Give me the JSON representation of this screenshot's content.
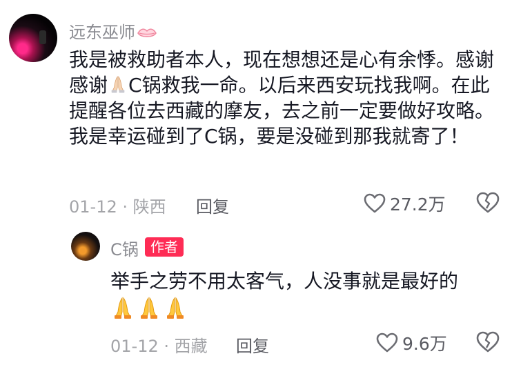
{
  "comment": {
    "author": "远东巫师",
    "author_icon": "lips-icon",
    "text_1": "我是被救助者本人，现在想想还是心有余悸。感谢感谢",
    "text_emoji": "pray-icon",
    "text_2": "C锅救我一命。以后来西安玩找我啊。在此提醒各位去西藏的摩友，去之前一定要做好攻略。我是幸运碰到了C锅，要是没碰到那我就寄了！",
    "date": "01-12",
    "location": "陕西",
    "reply_label": "回复",
    "likes": "27.2万"
  },
  "reply": {
    "author": "C锅",
    "badge": "作者",
    "text": "举手之劳不用太客气，人没事就是最好的",
    "emojis": [
      "pray-icon",
      "pray-icon",
      "pray-icon"
    ],
    "date": "01-12",
    "location": "西藏",
    "reply_label": "回复",
    "likes": "9.6万"
  },
  "colors": {
    "badge_bg": "#fe2c55",
    "meta_text": "#a3a4a8",
    "main_text": "#161823"
  }
}
